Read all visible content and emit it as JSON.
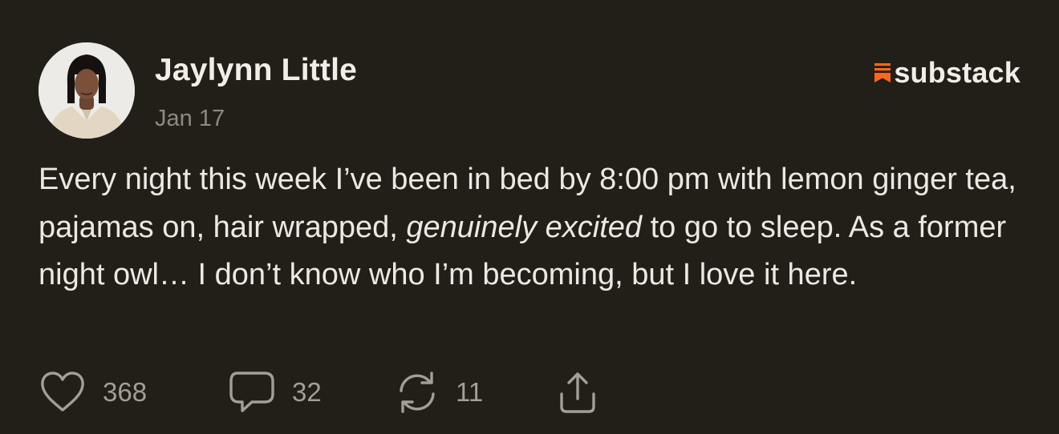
{
  "post": {
    "author_name": "Jaylynn Little",
    "date": "Jan 17",
    "body_part1": "Every night this week I’ve been in bed by 8:00 pm with lemon ginger tea, pajamas on, hair wrapped, ",
    "body_emphasis": "genuinely excited",
    "body_part2": " to go to sleep. As a former night owl… I don’t know who I’m becoming, but I love it here."
  },
  "brand": {
    "name": "substack",
    "icon": "substack-logo-icon",
    "accent_color": "#ff6719"
  },
  "actions": {
    "like_icon": "heart-icon",
    "like_count": "368",
    "comment_icon": "comment-bubble-icon",
    "comment_count": "32",
    "restack_icon": "restack-icon",
    "restack_count": "11",
    "share_icon": "share-icon"
  },
  "colors": {
    "background": "#221f19",
    "text_primary": "#ece9e3",
    "text_muted": "#8e8a82"
  }
}
